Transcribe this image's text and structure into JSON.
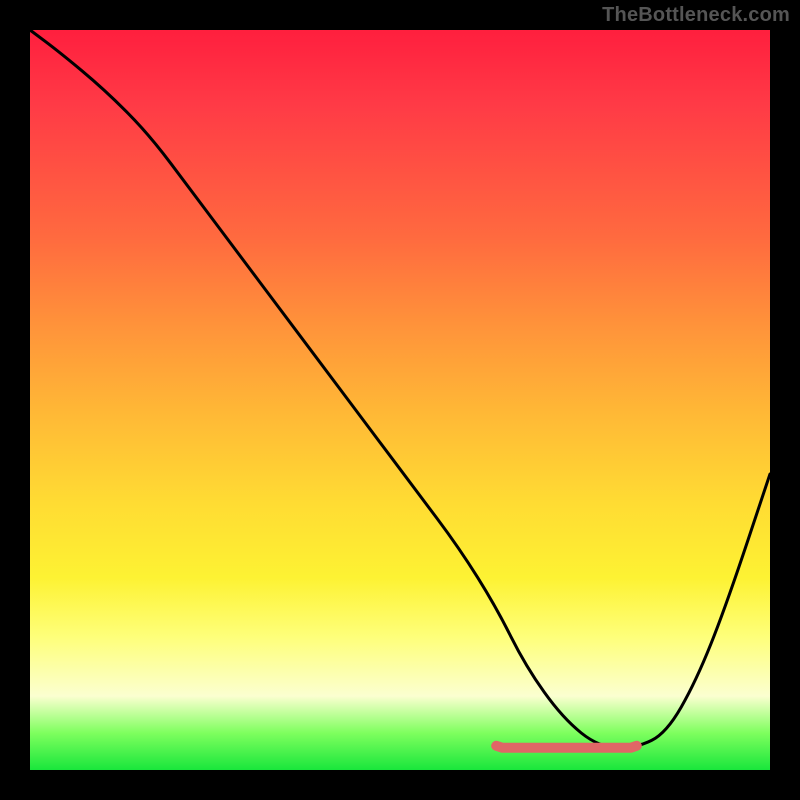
{
  "watermark": "TheBottleneck.com",
  "colors": {
    "background": "#000000",
    "curve_stroke": "#000000",
    "flat_marker": "#e06666",
    "gradient_stops": [
      "#ff1f3e",
      "#ff3a46",
      "#ff6a3f",
      "#ff933a",
      "#ffb936",
      "#ffdc33",
      "#fdf233",
      "#feff7a",
      "#fbffd0",
      "#7eff5e",
      "#19e63c"
    ]
  },
  "chart_data": {
    "type": "line",
    "title": "",
    "xlabel": "",
    "ylabel": "",
    "xlim": [
      0,
      100
    ],
    "ylim": [
      0,
      100
    ],
    "x": [
      0,
      4,
      10,
      16,
      22,
      28,
      34,
      40,
      46,
      52,
      58,
      63,
      67,
      72,
      77,
      82,
      86,
      90,
      94,
      100
    ],
    "values": [
      100,
      97,
      92,
      86,
      78,
      70,
      62,
      54,
      46,
      38,
      30,
      22,
      14,
      7,
      3,
      3,
      5,
      12,
      22,
      40
    ],
    "flat_region_x": [
      63,
      82
    ],
    "flat_region_y": 3,
    "annotations": []
  }
}
